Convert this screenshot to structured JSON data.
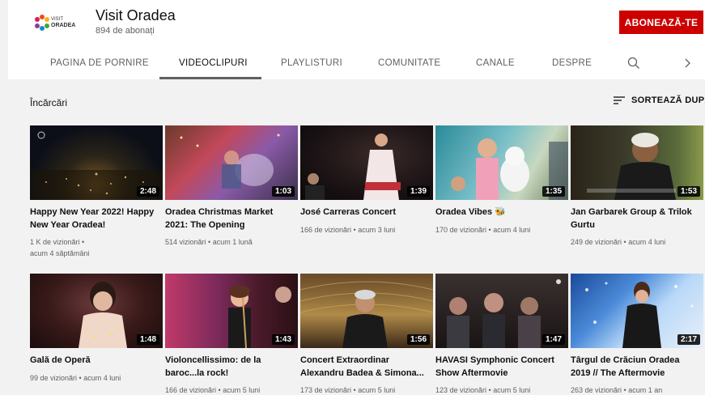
{
  "channel": {
    "name": "Visit Oradea",
    "subscribers": "894 de abonați",
    "logo_text_top": "VISIT",
    "logo_text_bottom": "ORADEA",
    "subscribe_label": "ABONEAZĂ-TE"
  },
  "tabs": [
    {
      "label": "PAGINA DE PORNIRE",
      "active": false
    },
    {
      "label": "VIDEOCLIPURI",
      "active": true
    },
    {
      "label": "PLAYLISTURI",
      "active": false
    },
    {
      "label": "COMUNITATE",
      "active": false
    },
    {
      "label": "CANALE",
      "active": false
    },
    {
      "label": "DESPRE",
      "active": false
    }
  ],
  "tab_icons": [
    "search-icon",
    "chevron-right-icon"
  ],
  "section": {
    "title": "Încărcări",
    "sort_label": "SORTEAZĂ DUPĂ",
    "sort_icon": "sort-icon"
  },
  "colors": {
    "accent": "#cc0000",
    "background": "#f2f2f2",
    "secondary_text": "#606060"
  },
  "videos": [
    {
      "title": "Happy New Year 2022! Happy New Year Oradea!",
      "duration": "2:48",
      "views": "1 K de vizionări •",
      "age": "acum 4 săptămâni"
    },
    {
      "title": "Oradea Christmas Market 2021: The Opening",
      "duration": "1:03",
      "views": "514 vizionări •",
      "age": "acum 1 lună"
    },
    {
      "title": "José Carreras Concert",
      "duration": "1:39",
      "views": "166 de vizionări •",
      "age": "acum 3 luni"
    },
    {
      "title": "Oradea Vibes 🐝",
      "duration": "1:35",
      "views": "170 de vizionări •",
      "age": "acum 4 luni"
    },
    {
      "title": "Jan Garbarek Group & Trilok Gurtu",
      "duration": "1:53",
      "views": "249 de vizionări •",
      "age": "acum 4 luni"
    },
    {
      "title": "Gală de Operă",
      "duration": "1:48",
      "views": "99 de vizionări •",
      "age": "acum 4 luni"
    },
    {
      "title": "Violoncellissimo: de la baroc...la rock!",
      "duration": "1:43",
      "views": "166 de vizionări •",
      "age": "acum 5 luni"
    },
    {
      "title": "Concert Extraordinar Alexandru Badea & Simona...",
      "duration": "1:56",
      "views": "173 de vizionări •",
      "age": "acum 5 luni"
    },
    {
      "title": "HAVASI Symphonic Concert Show Aftermovie",
      "duration": "1:47",
      "views": "123 de vizionări •",
      "age": "acum 5 luni"
    },
    {
      "title": "Târgul de Crăciun Oradea 2019 // The Aftermovie",
      "duration": "2:17",
      "views": "263 de vizionări •",
      "age": "acum 1 an"
    }
  ]
}
